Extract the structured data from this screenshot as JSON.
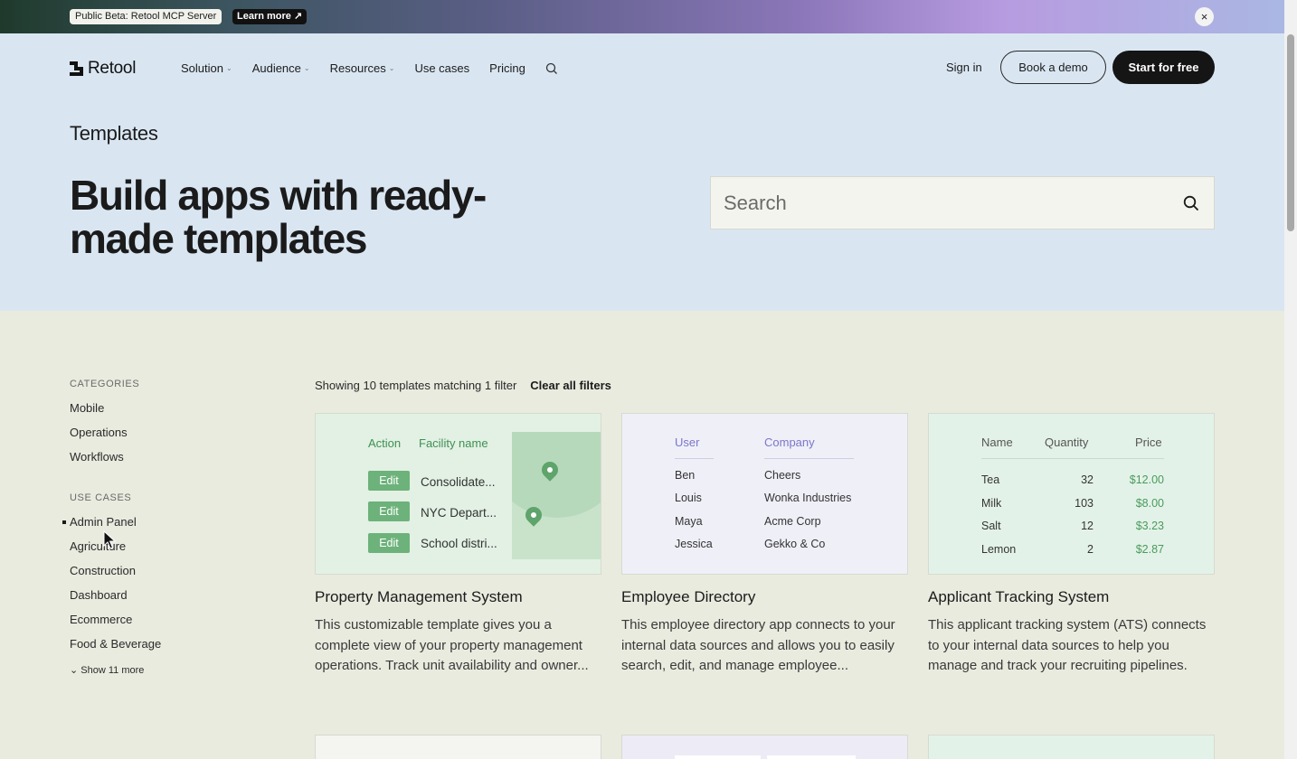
{
  "banner": {
    "beta_label": "Public Beta: Retool MCP Server",
    "learn_more": "Learn more ↗",
    "close": "×"
  },
  "header": {
    "brand": "Retool",
    "nav": [
      {
        "label": "Solution",
        "dropdown": true
      },
      {
        "label": "Audience",
        "dropdown": true
      },
      {
        "label": "Resources",
        "dropdown": true
      },
      {
        "label": "Use cases",
        "dropdown": false
      },
      {
        "label": "Pricing",
        "dropdown": false
      }
    ],
    "sign_in": "Sign in",
    "book_demo": "Book a demo",
    "start_free": "Start for free"
  },
  "hero": {
    "breadcrumb": "Templates",
    "title": "Build apps with ready-made templates",
    "search_placeholder": "Search"
  },
  "sidebar": {
    "categories_title": "CATEGORIES",
    "categories": [
      "Mobile",
      "Operations",
      "Workflows"
    ],
    "use_cases_title": "USE CASES",
    "use_cases": [
      {
        "label": "Admin Panel",
        "active": true
      },
      {
        "label": "Agriculture",
        "active": false
      },
      {
        "label": "Construction",
        "active": false
      },
      {
        "label": "Dashboard",
        "active": false
      },
      {
        "label": "Ecommerce",
        "active": false
      },
      {
        "label": "Food & Beverage",
        "active": false
      }
    ],
    "show_more": "Show 11 more"
  },
  "results": {
    "count_text": "Showing 10 templates matching 1 filter",
    "clear_filters": "Clear all filters"
  },
  "cards": [
    {
      "title": "Property Management System",
      "description": "This customizable template gives you a complete view of your property management operations. Track unit availability and owner...",
      "preview": {
        "headers": [
          "Action",
          "Facility name"
        ],
        "edit_label": "Edit",
        "rows": [
          "Consolidate...",
          "NYC Depart...",
          "School distri..."
        ]
      }
    },
    {
      "title": "Employee Directory",
      "description": "This employee directory app connects to your internal data sources and allows you to easily search, edit, and manage employee...",
      "preview": {
        "headers": [
          "User",
          "Company"
        ],
        "rows": [
          [
            "Ben",
            "Cheers"
          ],
          [
            "Louis",
            "Wonka Industries"
          ],
          [
            "Maya",
            "Acme Corp"
          ],
          [
            "Jessica",
            "Gekko & Co"
          ]
        ]
      }
    },
    {
      "title": "Applicant Tracking System",
      "description": "This applicant tracking system (ATS) connects to your internal data sources to help you manage and track your recruiting pipelines.",
      "preview": {
        "headers": [
          "Name",
          "Quantity",
          "Price"
        ],
        "rows": [
          [
            "Tea",
            "32",
            "$12.00"
          ],
          [
            "Milk",
            "103",
            "$8.00"
          ],
          [
            "Salt",
            "12",
            "$3.23"
          ],
          [
            "Lemon",
            "2",
            "$2.87"
          ]
        ]
      }
    }
  ],
  "colors": {
    "hero_bg": "#d9e6f2",
    "page_bg": "#e9ebdf",
    "accent_green": "#6db27b",
    "accent_purple": "#7b76c9",
    "button_dark": "#151515"
  }
}
